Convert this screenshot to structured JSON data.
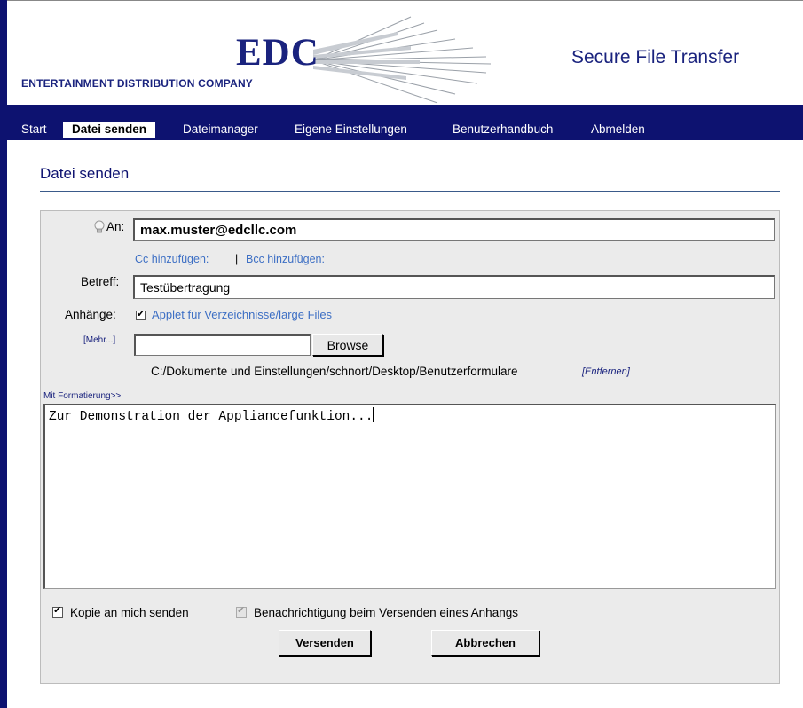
{
  "header": {
    "logo_text": "EDC",
    "company_name": "ENTERTAINMENT DISTRIBUTION COMPANY",
    "app_title": "Secure File Transfer"
  },
  "nav": {
    "tabs": [
      {
        "label": "Start"
      },
      {
        "label": "Datei senden",
        "active": true
      },
      {
        "label": "Dateimanager"
      },
      {
        "label": "Eigene Einstellungen"
      },
      {
        "label": "Benutzerhandbuch"
      },
      {
        "label": "Abmelden"
      }
    ]
  },
  "page": {
    "title": "Datei senden"
  },
  "form": {
    "to_label": "An:",
    "to_value": "max.muster@edcllc.com",
    "cc_link": "Cc hinzufügen:",
    "separator": "|",
    "bcc_link": "Bcc hinzufügen:",
    "subject_label": "Betreff:",
    "subject_value": "Testübertragung",
    "attachments_label": "Anhänge:",
    "applet_label": "Applet für Verzeichnisse/large Files",
    "applet_checked": true,
    "more_link": "[Mehr...]",
    "file_value": "",
    "browse_label": "Browse",
    "file_path": "C:/Dokumente und Einstellungen/schnort/Desktop/Benutzerformulare",
    "remove_link": "[Entfernen]",
    "format_link": "Mit Formatierung>>",
    "message": "Zur Demonstration der Appliancefunktion...",
    "copy_label": "Kopie an mich senden",
    "copy_checked": true,
    "notify_label": "Benachrichtigung beim Versenden eines Anhangs",
    "notify_checked": true,
    "notify_disabled": true,
    "send_label": "Versenden",
    "cancel_label": "Abbrechen"
  },
  "colors": {
    "navy": "#0d1270",
    "brand_blue": "#1a237e",
    "link_blue": "#3d6fc4",
    "panel_bg": "#ebebeb"
  },
  "icons": {
    "hint": "lightbulb-icon",
    "logo_graphic": "light-rays-icon"
  }
}
